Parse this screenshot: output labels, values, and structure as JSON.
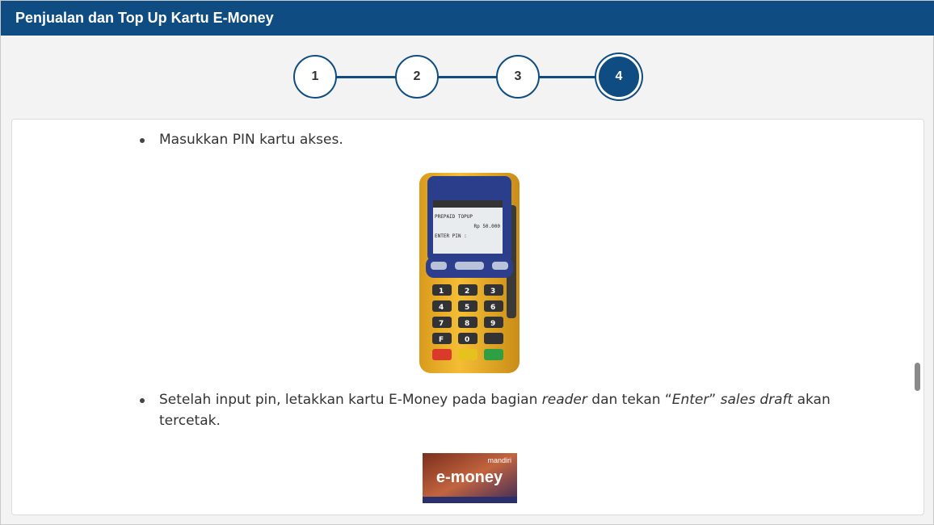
{
  "title": "Penjualan dan Top Up Kartu E-Money",
  "steps": [
    "1",
    "2",
    "3",
    "4"
  ],
  "active_step": 4,
  "content": {
    "bullet1": "Masukkan PIN kartu akses.",
    "bullet2_parts": {
      "a": "Setelah input pin, letakkan kartu E-Money pada bagian ",
      "b": "reader",
      "c": " dan tekan “",
      "d": "Enter",
      "e": "” ",
      "f": "sales draft",
      "g": " akan tercetak."
    },
    "edc_screen": {
      "line1": "PREPAID TOPUP",
      "line2": "Rp 50.000",
      "line3": "ENTER PIN :"
    },
    "keypad": [
      [
        "1",
        "2",
        "3"
      ],
      [
        "4",
        "5",
        "6"
      ],
      [
        "7",
        "8",
        "9"
      ],
      [
        "F",
        "0",
        ""
      ]
    ],
    "card": {
      "brand": "mandiri",
      "name": "e-money"
    }
  },
  "colors": {
    "header": "#0f4c81",
    "step_active": "#0f4c81",
    "edc_body": "#f2b52a",
    "edc_screen_frame": "#2b3e8c"
  }
}
